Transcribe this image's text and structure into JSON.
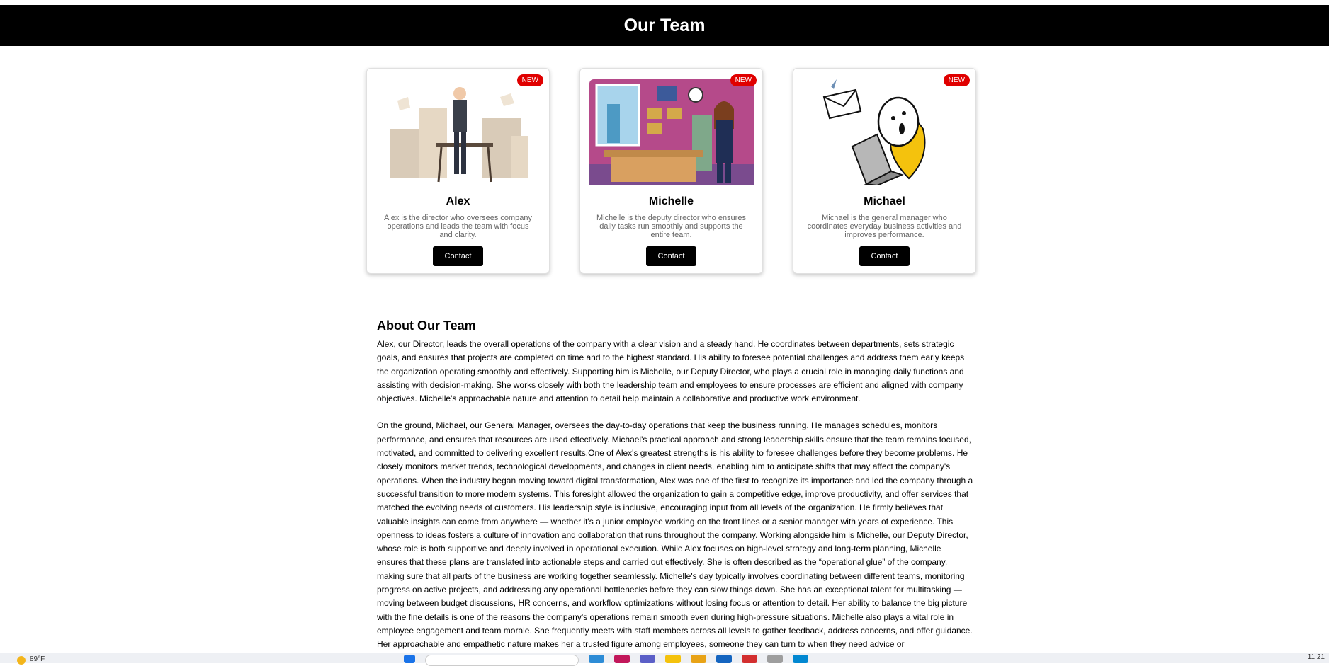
{
  "header": {
    "title": "Our Team"
  },
  "team": [
    {
      "badge": "NEW",
      "name": "Alex",
      "description": "Alex is the director who oversees company operations and leads the team with focus and clarity.",
      "button": "Contact",
      "avatar": "businessman-with-paper-stacks-illustration"
    },
    {
      "badge": "NEW",
      "name": "Michelle",
      "description": "Michelle is the deputy director who ensures daily tasks run smoothly and supports the entire team.",
      "button": "Contact",
      "avatar": "businesswoman-in-office-illustration"
    },
    {
      "badge": "NEW",
      "name": "Michael",
      "description": "Michael is the general manager who coordinates everyday business activities and improves performance.",
      "button": "Contact",
      "avatar": "stick-figure-with-laptop-and-email-illustration"
    }
  ],
  "about": {
    "title": "About Our Team",
    "paragraphs": [
      "Alex, our Director, leads the overall operations of the company with a clear vision and a steady hand. He coordinates between departments, sets strategic goals, and ensures that projects are completed on time and to the highest standard. His ability to foresee potential challenges and address them early keeps the organization operating smoothly and effectively. Supporting him is Michelle, our Deputy Director, who plays a crucial role in managing daily functions and assisting with decision-making. She works closely with both the leadership team and employees to ensure processes are efficient and aligned with company objectives. Michelle's approachable nature and attention to detail help maintain a collaborative and productive work environment.",
      "On the ground, Michael, our General Manager, oversees the day-to-day operations that keep the business running. He manages schedules, monitors performance, and ensures that resources are used effectively. Michael's practical approach and strong leadership skills ensure that the team remains focused, motivated, and committed to delivering excellent results.One of Alex's greatest strengths is his ability to foresee challenges before they become problems. He closely monitors market trends, technological developments, and changes in client needs, enabling him to anticipate shifts that may affect the company's operations. When the industry began moving toward digital transformation, Alex was one of the first to recognize its importance and led the company through a successful transition to more modern systems. This foresight allowed the organization to gain a competitive edge, improve productivity, and offer services that matched the evolving needs of customers. His leadership style is inclusive, encouraging input from all levels of the organization. He firmly believes that valuable insights can come from anywhere — whether it's a junior employee working on the front lines or a senior manager with years of experience. This openness to ideas fosters a culture of innovation and collaboration that runs throughout the company. Working alongside him is Michelle, our Deputy Director, whose role is both supportive and deeply involved in operational execution. While Alex focuses on high-level strategy and long-term planning, Michelle ensures that these plans are translated into actionable steps and carried out effectively. She is often described as the “operational glue” of the company, making sure that all parts of the business are working together seamlessly. Michelle's day typically involves coordinating between different teams, monitoring progress on active projects, and addressing any operational bottlenecks before they can slow things down. She has an exceptional talent for multitasking — moving between budget discussions, HR concerns, and workflow optimizations without losing focus or attention to detail. Her ability to balance the big picture with the fine details is one of the reasons the company's operations remain smooth even during high-pressure situations. Michelle also plays a vital role in employee engagement and team morale. She frequently meets with staff members across all levels to gather feedback, address concerns, and offer guidance. Her approachable and empathetic nature makes her a trusted figure among employees, someone they can turn to when they need advice or"
    ]
  },
  "taskbar": {
    "weather": "89°F",
    "time": "11:21"
  }
}
